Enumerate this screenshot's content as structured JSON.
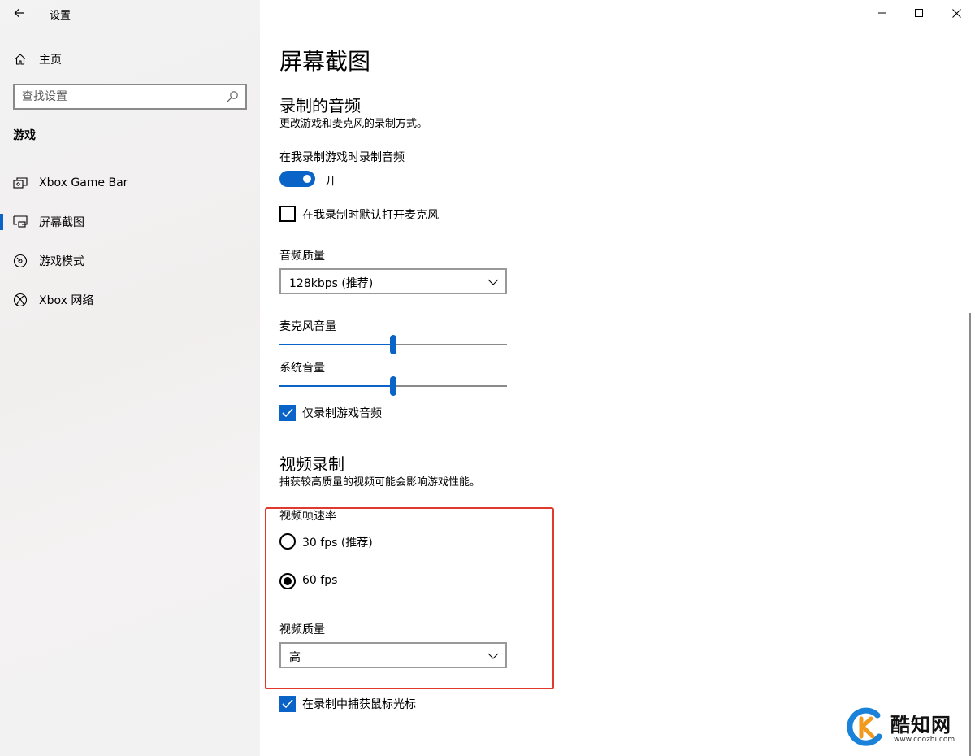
{
  "window": {
    "title": "设置",
    "controls": [
      "minimize",
      "maximize",
      "close"
    ]
  },
  "sidebar": {
    "home_label": "主页",
    "search_placeholder": "查找设置",
    "section_title": "游戏",
    "items": [
      {
        "label": "Xbox Game Bar",
        "icon": "gamebar-icon",
        "active": false
      },
      {
        "label": "屏幕截图",
        "icon": "capture-icon",
        "active": true
      },
      {
        "label": "游戏模式",
        "icon": "gamemode-icon",
        "active": false
      },
      {
        "label": "Xbox 网络",
        "icon": "xbox-icon",
        "active": false
      }
    ]
  },
  "main": {
    "page_title": "屏幕截图",
    "audio": {
      "heading": "录制的音频",
      "description": "更改游戏和麦克风的录制方式。",
      "record_audio_label": "在我录制游戏时录制音频",
      "record_audio_state": "开",
      "record_audio_on": true,
      "mic_default_label": "在我录制时默认打开麦克风",
      "mic_default_checked": false,
      "quality_label": "音频质量",
      "quality_value": "128kbps (推荐)",
      "mic_volume_label": "麦克风音量",
      "mic_volume": 0.5,
      "system_volume_label": "系统音量",
      "system_volume": 0.5,
      "game_audio_only_label": "仅录制游戏音频",
      "game_audio_only_checked": true
    },
    "video": {
      "heading": "视频录制",
      "description": "捕获较高质量的视频可能会影响游戏性能。",
      "frame_rate_label": "视频帧速率",
      "frame_rate_options": [
        "30 fps (推荐)",
        "60 fps"
      ],
      "frame_rate_selected": 1,
      "quality_label": "视频质量",
      "quality_value": "高",
      "capture_cursor_label": "在录制中捕获鼠标光标",
      "capture_cursor_checked": true
    }
  },
  "colors": {
    "accent": "#0a63c7",
    "highlight_box": "#e0392e",
    "sidebar_bg": "#f2f2f2"
  },
  "watermark": {
    "name": "酷知网",
    "url": "www.coozhi.com"
  }
}
